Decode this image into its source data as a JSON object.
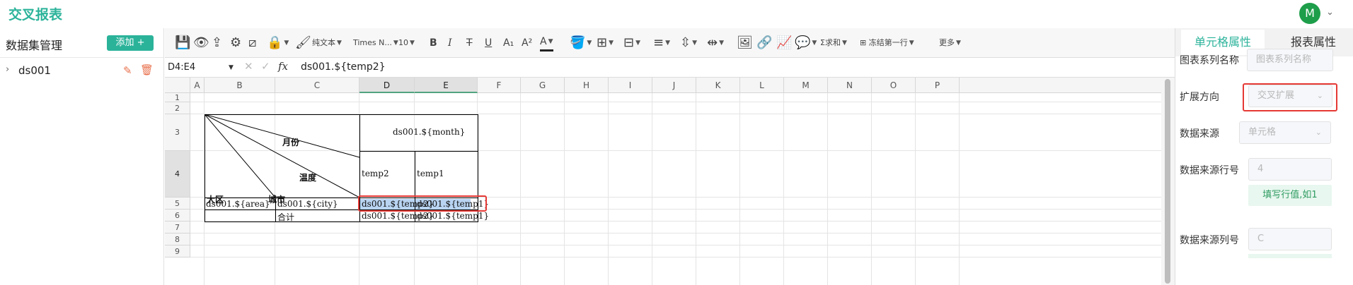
{
  "app": {
    "title": "交叉报表",
    "avatar_letter": "M",
    "accent": "#2bb39a"
  },
  "left": {
    "title": "数据集管理",
    "add_label": "添加 +",
    "datasets": [
      {
        "name": "ds001"
      }
    ]
  },
  "toolbar": {
    "rich_text": "纯文本",
    "font_family": "Times N...",
    "font_size": "10",
    "bold": "B",
    "italic": "I",
    "strike": "T",
    "underline": "U",
    "subscript": "A₁",
    "superscript": "A²",
    "font_color": "A",
    "sum": "求和",
    "freeze": "冻结第一行",
    "more": "更多"
  },
  "formula": {
    "cell_ref": "D4:E4",
    "fx": "fx",
    "value": "ds001.${temp2}"
  },
  "sheet": {
    "columns": [
      "A",
      "B",
      "C",
      "D",
      "E",
      "F",
      "G",
      "H",
      "I",
      "J",
      "K",
      "L",
      "M",
      "N",
      "O",
      "P"
    ],
    "selected_columns": [
      "D",
      "E"
    ],
    "rows": [
      "1",
      "2",
      "3",
      "4",
      "5",
      "6",
      "7",
      "8",
      "9"
    ],
    "selected_row": "4",
    "cells": {
      "diag_month": "月份",
      "diag_temp": "温度",
      "diag_region": "大区",
      "diag_city": "城市",
      "month": "ds001.${month}",
      "temp2_head": "temp2",
      "temp1_head": "temp1",
      "r4_area": "ds001.${area}",
      "r4_city": "ds001.${city}",
      "r4_temp2": "ds001.${temp2}",
      "r4_temp1": "ds001.${temp1}",
      "r5_total": "合计",
      "r5_temp2": "ds001.${temp2}",
      "r5_temp1": "ds001.${temp1}"
    }
  },
  "props": {
    "tab_cell": "单元格属性",
    "tab_report": "报表属性",
    "series_name_label": "图表系列名称",
    "series_name_placeholder": "图表系列名称",
    "expand_dir_label": "扩展方向",
    "expand_dir_value": "交叉扩展",
    "source_label": "数据来源",
    "source_value": "单元格",
    "source_row_label": "数据来源行号",
    "source_row_value": "4",
    "row_hint": "填写行值,如1",
    "source_col_label": "数据来源列号",
    "source_col_value": "C"
  }
}
